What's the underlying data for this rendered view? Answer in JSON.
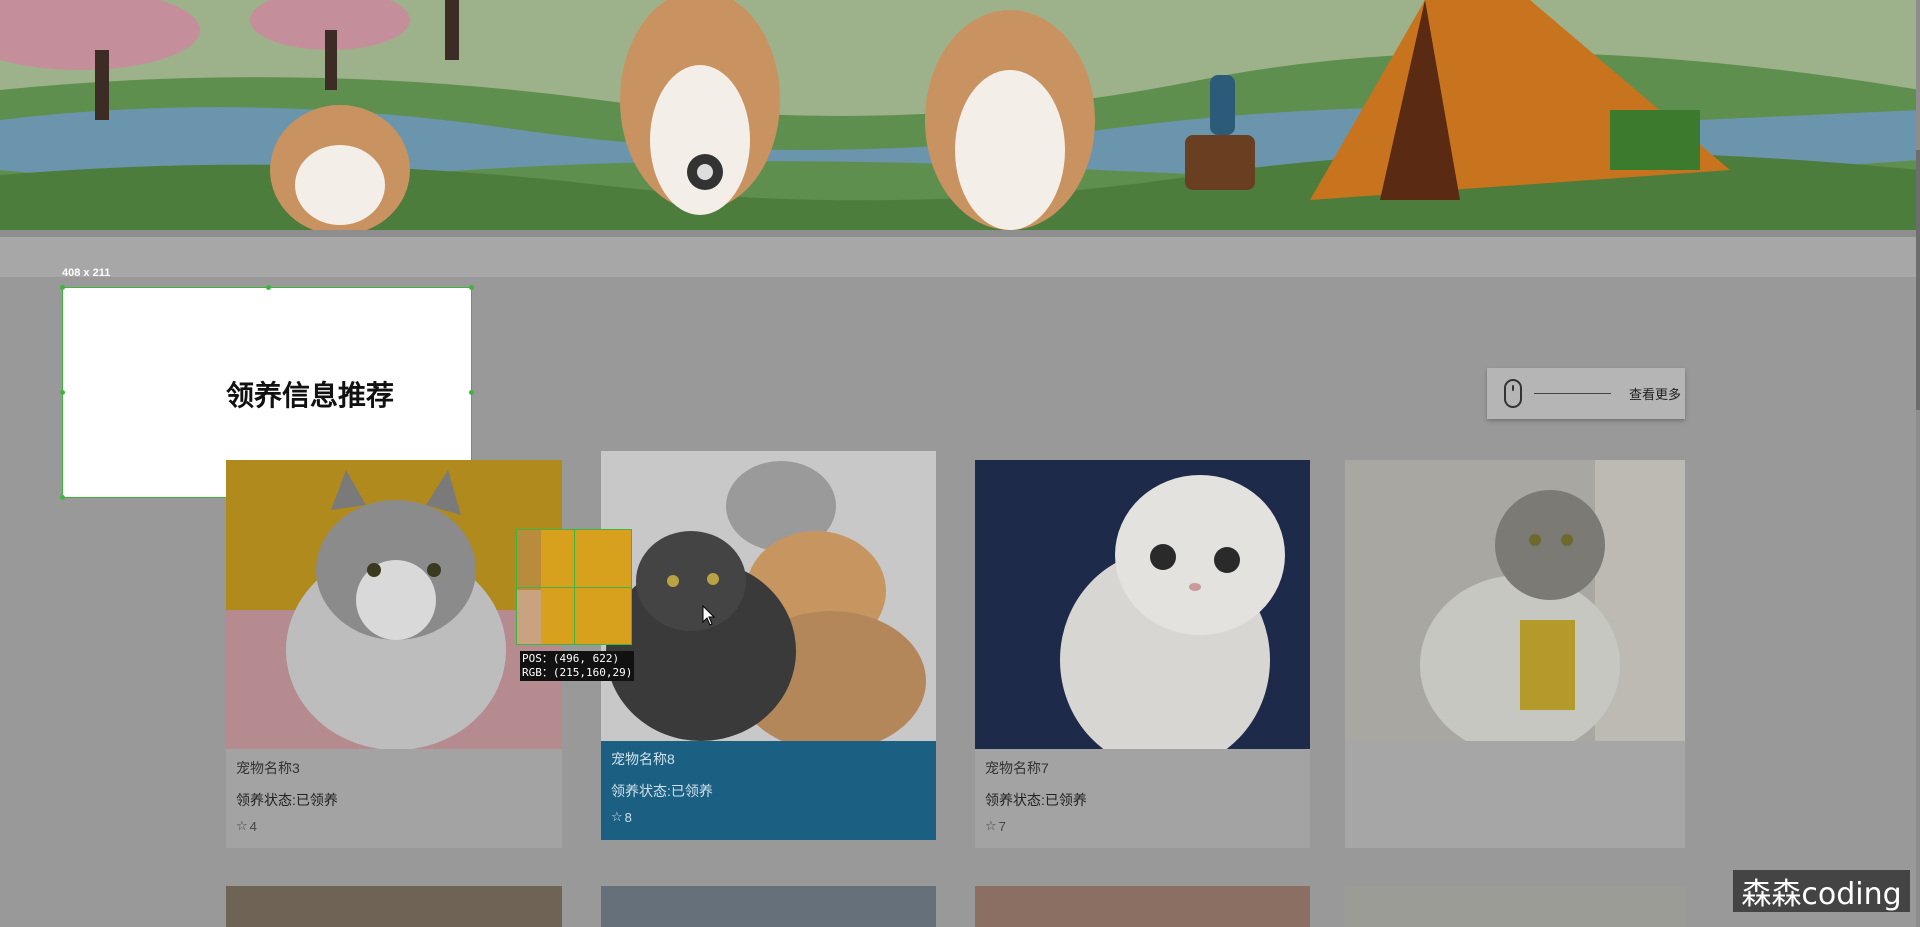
{
  "section": {
    "title": "领养信息推荐"
  },
  "selection": {
    "size_label": "408 x 211"
  },
  "see_more": {
    "label": "查看更多",
    "icon": "mouse-icon"
  },
  "picker": {
    "pos": "POS：(496, 622)",
    "rgb": "RGB：(215,160,29)",
    "color": "#d7a01d"
  },
  "cards": [
    {
      "name": "宠物名称3",
      "status": "领养状态:已领养",
      "likes": "4",
      "highlight": false
    },
    {
      "name": "宠物名称8",
      "status": "领养状态:已领养",
      "likes": "8",
      "highlight": true
    },
    {
      "name": "宠物名称7",
      "status": "领养状态:已领养",
      "likes": "7",
      "highlight": false
    },
    {
      "name": "",
      "status": "",
      "likes": "",
      "highlight": false
    }
  ],
  "watermark": {
    "text": "森森coding"
  },
  "colors": {
    "active_card": "#1b5f82",
    "selection": "#3fb53f",
    "overlay": "#999999"
  }
}
